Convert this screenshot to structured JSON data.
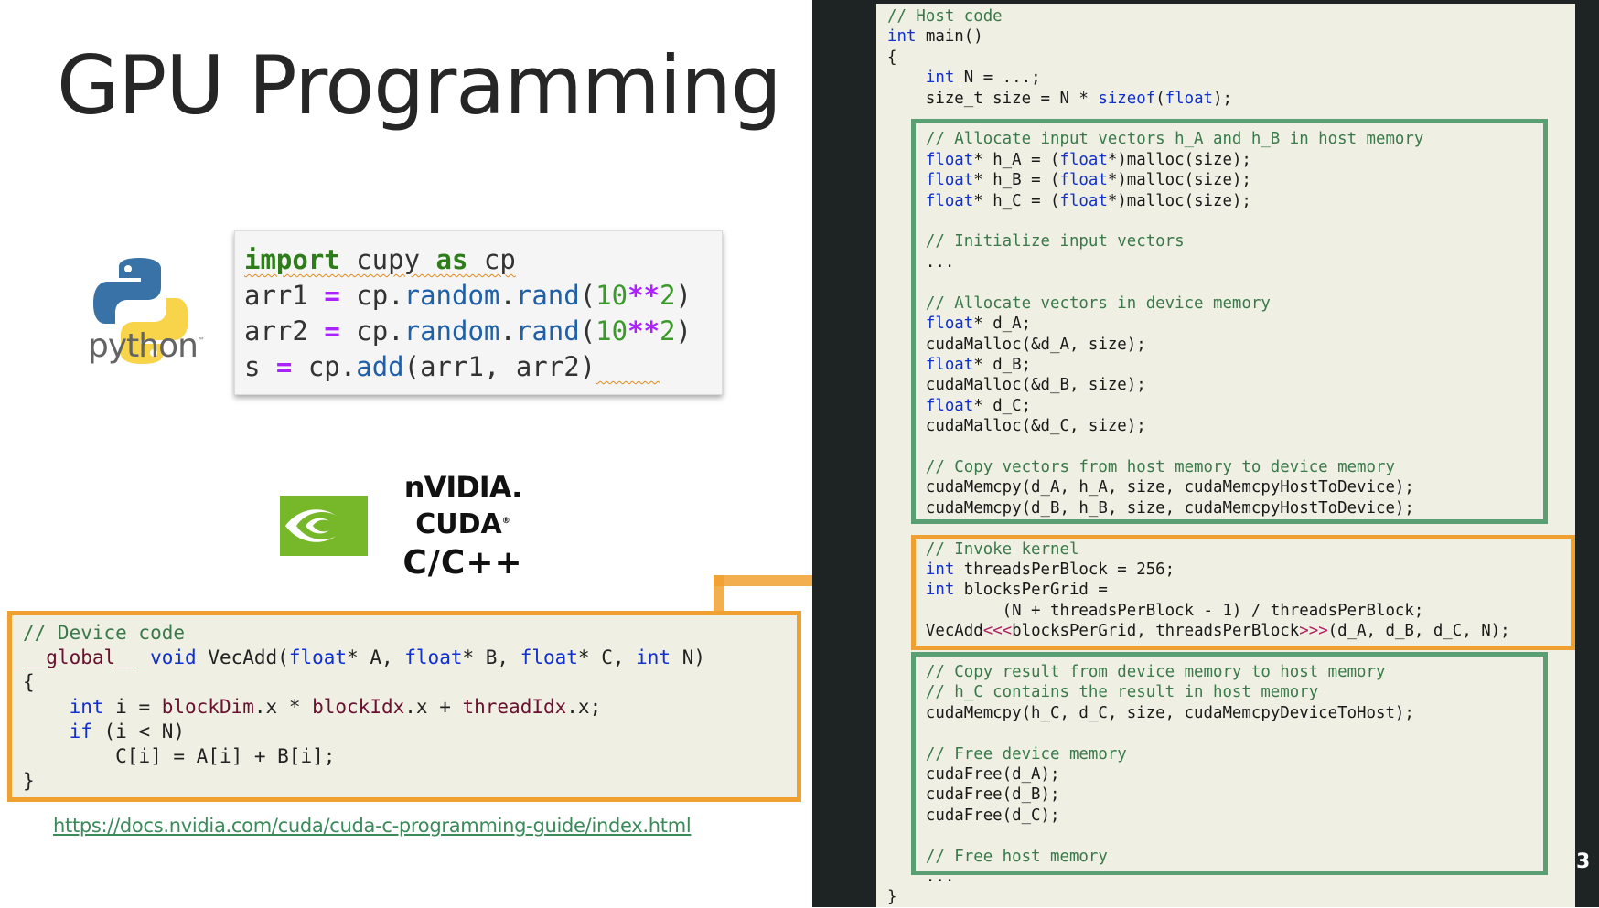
{
  "slide": {
    "title": "GPU Programming",
    "page_number": "3",
    "link": "https://docs.nvidia.com/cuda/cuda-c-programming-guide/index.html"
  },
  "python_logo": {
    "word": "python",
    "tm": "™"
  },
  "cupy_code": {
    "line1": {
      "kw_import": "import",
      "mid1": " cupy ",
      "kw_as": "as",
      "mid2": " cp"
    },
    "line2": {
      "var": "arr1 ",
      "eq": "=",
      "obj": " cp.",
      "fn1": "random",
      "dot": ".",
      "fn2": "rand",
      "open": "(",
      "num1": "10",
      "op": "**",
      "num2": "2",
      "close": ")"
    },
    "line3": {
      "var": "arr2 ",
      "eq": "=",
      "obj": " cp.",
      "fn1": "random",
      "dot": ".",
      "fn2": "rand",
      "open": "(",
      "num1": "10",
      "op": "**",
      "num2": "2",
      "close": ")"
    },
    "line4": {
      "var": "s ",
      "eq": "=",
      "obj": " cp.",
      "fn": "add",
      "args": "(arr1, arr2)",
      "trail": "    "
    }
  },
  "nvidia_logo": {
    "brand": "nVIDIA.",
    "product": "CUDA",
    "reg": "®",
    "lang": "C/C++"
  },
  "device_code": {
    "comment": "// Device code",
    "sig_global": "__global__",
    "sig_void": "void",
    "sig_name": " VecAdd(",
    "sig_float": "float",
    "sig_a": "* A, ",
    "sig_b": "* B, ",
    "sig_c": "* C, ",
    "sig_int": "int",
    "sig_end": " N)",
    "open_brace": "{",
    "l_int": "int",
    "l_i": " i = ",
    "l_bdim": "blockDim",
    "l_x1": ".x * ",
    "l_bidx": "blockIdx",
    "l_x2": ".x + ",
    "l_tidx": "threadIdx",
    "l_x3": ".x;",
    "if_kw": "if",
    "if_rest": " (i < N)",
    "assign": "C[i] = A[i] + B[i];",
    "close_brace": "}"
  },
  "host_code": {
    "c_host": "// Host code",
    "int": "int",
    "float": "float",
    "sizeof": "sizeof",
    "main": " main()",
    "open_brace": "{",
    "n_decl": " N = ...;",
    "size_decl_a": "size_t size = N * ",
    "size_decl_b": "(",
    "size_decl_c": ");",
    "c_alloc_host": "// Allocate input vectors h_A and h_B in host memory",
    "h_a_1": "* h_A = (",
    "h_a_2": "*)malloc(size);",
    "h_b_1": "* h_B = (",
    "h_b_2": "*)malloc(size);",
    "h_c_1": "* h_C = (",
    "h_c_2": "*)malloc(size);",
    "c_init": "// Initialize input vectors",
    "ellipsis": "...",
    "c_alloc_dev": "// Allocate vectors in device memory",
    "d_a_decl": "* d_A;",
    "malloc_a": "cudaMalloc(&d_A, size);",
    "d_b_decl": "* d_B;",
    "malloc_b": "cudaMalloc(&d_B, size);",
    "d_c_decl": "* d_C;",
    "malloc_c": "cudaMalloc(&d_C, size);",
    "c_copy_h2d": "// Copy vectors from host memory to device memory",
    "memcpy_a": "cudaMemcpy(d_A, h_A, size, cudaMemcpyHostToDevice);",
    "memcpy_b": "cudaMemcpy(d_B, h_B, size, cudaMemcpyHostToDevice);",
    "c_invoke": "// Invoke kernel",
    "tpb": " threadsPerBlock = 256;",
    "bpg": " blocksPerGrid =",
    "bpg_expr": "        (N + threadsPerBlock - 1) / threadsPerBlock;",
    "launch_a": "VecAdd",
    "launch_lt": "<<<",
    "launch_mid": "blocksPerGrid, threadsPerBlock",
    "launch_gt": ">>>",
    "launch_end": "(d_A, d_B, d_C, N);",
    "c_copy_d2h": "// Copy result from device memory to host memory",
    "c_hc": "// h_C contains the result in host memory",
    "memcpy_c": "cudaMemcpy(h_C, d_C, size, cudaMemcpyDeviceToHost);",
    "c_free_dev": "// Free device memory",
    "free_a": "cudaFree(d_A);",
    "free_b": "cudaFree(d_B);",
    "free_c": "cudaFree(d_C);",
    "c_free_host": "// Free host memory",
    "close_brace": "}"
  }
}
